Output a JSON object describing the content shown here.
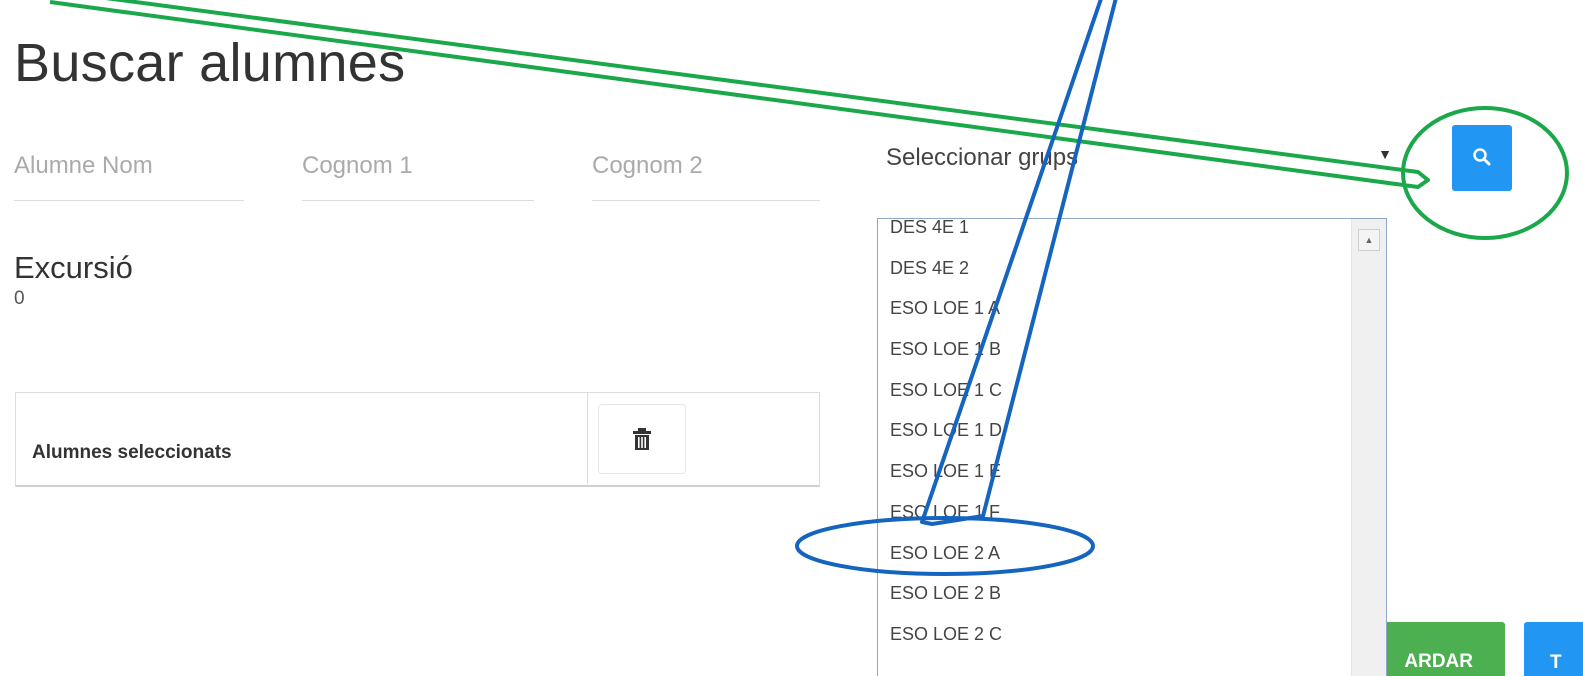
{
  "page": {
    "title": "Buscar alumnes"
  },
  "filters": {
    "name_placeholder": "Alumne Nom",
    "surname1_placeholder": "Cognom 1",
    "surname2_placeholder": "Cognom 2",
    "groups_select_value": "Seleccionar grups",
    "search_icon": "search-icon"
  },
  "excursion": {
    "label": "Excursió",
    "count": "0"
  },
  "selected_table": {
    "label": "Alumnes seleccionats",
    "delete_icon": "trash-icon"
  },
  "groups_dropdown": {
    "options": [
      "DES 4E 1",
      "DES 4E 2",
      "ESO LOE 1 A",
      "ESO LOE 1 B",
      "ESO LOE 1 C",
      "ESO LOE 1 D",
      "ESO LOE 1 E",
      "ESO LOE 1 F",
      "ESO LOE 2 A",
      "ESO LOE 2 B",
      "ESO LOE 2 C"
    ]
  },
  "actions": {
    "save_label": "ARDAR",
    "other_label": "T"
  },
  "annotations": {
    "green_color": "#1aa84a",
    "blue_color": "#1565c0"
  },
  "colors": {
    "primary": "#2196f3",
    "success": "#4caf50"
  }
}
